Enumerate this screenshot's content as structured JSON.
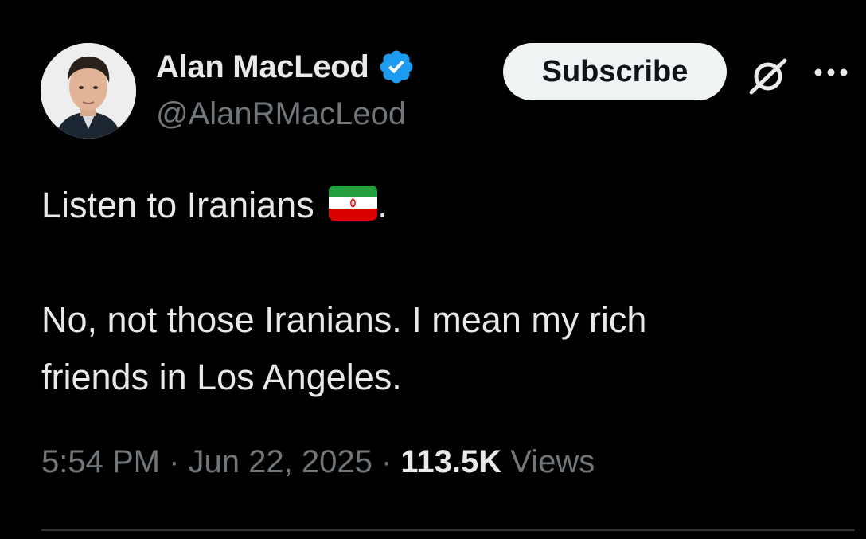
{
  "author": {
    "display_name": "Alan MacLeod",
    "handle": "@AlanRMacLeod",
    "verified": true,
    "verified_color": "#1d9bf0"
  },
  "actions": {
    "subscribe_label": "Subscribe",
    "grok_icon": "grok-icon",
    "more_icon": "more-horizontal-icon"
  },
  "tweet": {
    "line1": "Listen to Iranians",
    "line1_emoji": "iran-flag-emoji",
    "line1_suffix": ".",
    "line2": "No, not those Iranians. I mean my rich",
    "line3": "friends in Los Angeles."
  },
  "meta": {
    "time": "5:54 PM",
    "separator": " · ",
    "date": "Jun 22, 2025",
    "views_count": "113.5K",
    "views_label": "Views"
  },
  "colors": {
    "background": "#000000",
    "primary_text": "#e7e9ea",
    "secondary_text": "#71767b",
    "button_bg": "#eff3f4"
  }
}
